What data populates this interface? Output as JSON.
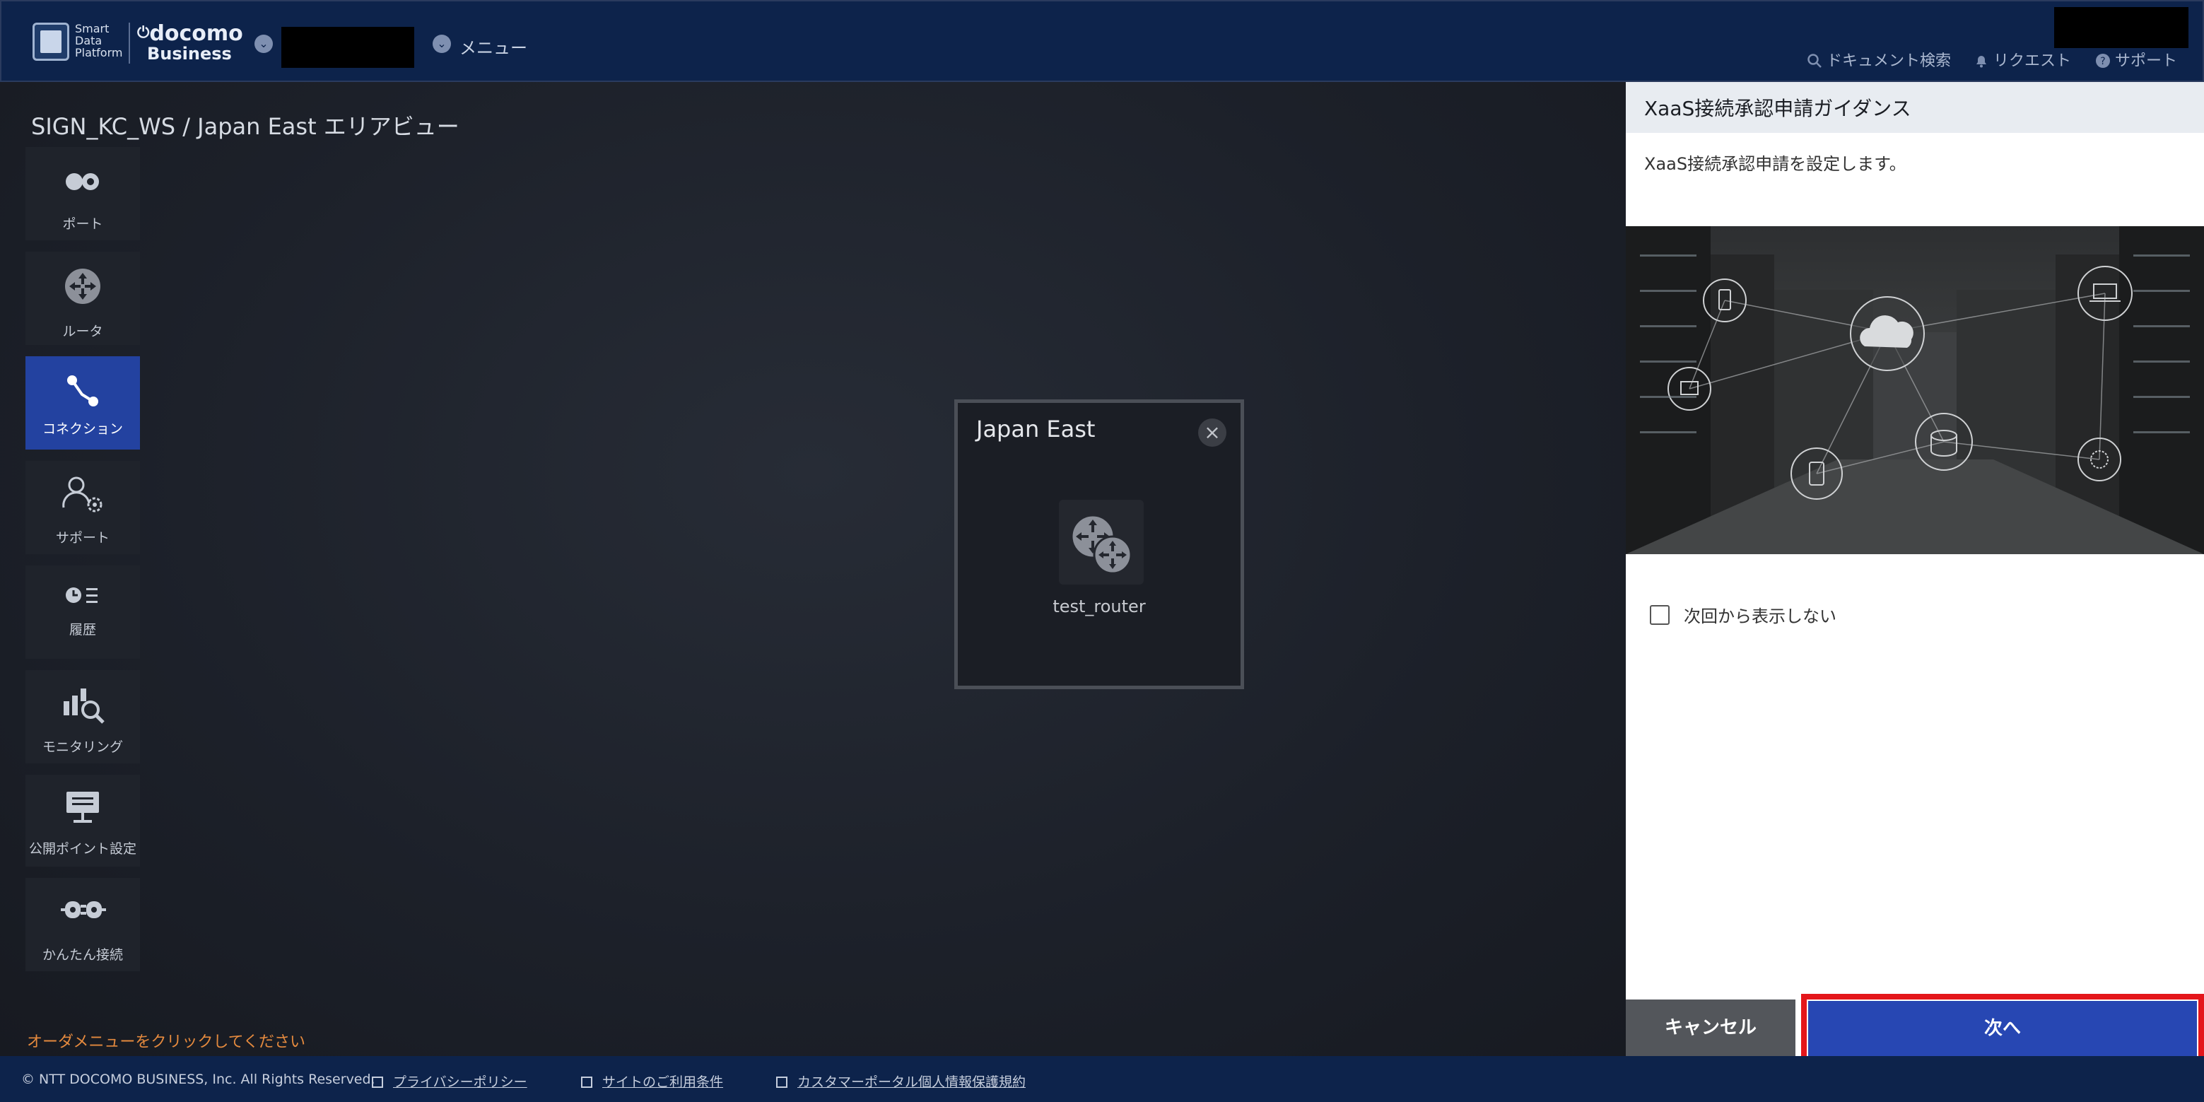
{
  "header": {
    "logo_line1": "Smart",
    "logo_line2": "Data",
    "logo_line3": "Platform",
    "brand_top": "docomo",
    "brand_bottom": "Business",
    "menu_label": "メニュー",
    "links": [
      {
        "label": "ドキュメント検索",
        "icon": "search-icon"
      },
      {
        "label": "リクエスト",
        "icon": "bell-icon"
      },
      {
        "label": "サポート",
        "icon": "help-icon"
      }
    ]
  },
  "page_title": "SIGN_KC_WS / Japan East エリアビュー",
  "sidebar": {
    "items": [
      {
        "label": "ポート",
        "icon": "port-icon"
      },
      {
        "label": "ルータ",
        "icon": "router-icon"
      },
      {
        "label": "コネクション",
        "icon": "connection-icon",
        "active": true
      },
      {
        "label": "サポート",
        "icon": "support-icon"
      },
      {
        "label": "履歴",
        "icon": "history-icon"
      },
      {
        "label": "モニタリング",
        "icon": "monitoring-icon"
      },
      {
        "label": "公開ポイント設定",
        "icon": "public-point-icon"
      },
      {
        "label": "かんたん接続",
        "icon": "easy-connect-icon"
      }
    ]
  },
  "hint": "オーダメニューをクリックしてください",
  "popup": {
    "title": "Japan East",
    "close_icon": "close-icon",
    "router_label": "test_router"
  },
  "panel": {
    "title": "XaaS接続承認申請ガイダンス",
    "description": "XaaS接続承認申請を設定します。",
    "checkbox_label": "次回から表示しない",
    "cancel_label": "キャンセル",
    "next_label": "次へ"
  },
  "footer": {
    "copyright": "© NTT DOCOMO BUSINESS, Inc. All Rights Reserved.",
    "links": [
      "プライバシーポリシー",
      "サイトのご利用条件",
      "カスタマーポータル個人情報保護規約"
    ]
  },
  "colors": {
    "header_bg": "#0d234b",
    "active_item": "#2342a0",
    "next_button": "#2747b3",
    "highlight": "#e4161b",
    "hint": "#e58a3e"
  }
}
